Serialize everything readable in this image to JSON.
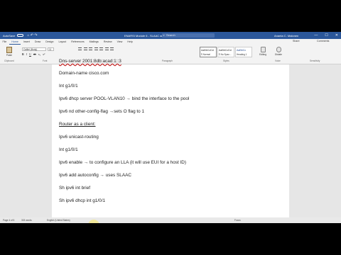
{
  "titlebar": {
    "autosave": "AutoSave",
    "document": "ENARSI Module 6 - SLAAC and DHCPv6",
    "search_placeholder": "Search",
    "user": "Ananta C. Malonen",
    "quick_access": "⌂ ↶ ↷"
  },
  "tabs": [
    "File",
    "Home",
    "Insert",
    "Draw",
    "Design",
    "Layout",
    "References",
    "Mailings",
    "Review",
    "View",
    "Help"
  ],
  "share_label": "Share",
  "comments_label": "Comments",
  "ribbon": {
    "paste_label": "Paste",
    "font_name": "Calibri (Body)",
    "font_size": "11",
    "clipboard_label": "Clipboard",
    "font_label": "Font",
    "paragraph_label": "Paragraph",
    "styles_label": "Styles",
    "editing_label": "Editing",
    "dictate_label": "Dictate",
    "voice_label": "Voice",
    "sensitivity_label": "Sensitivity",
    "styles": [
      {
        "preview": "AaBbCcDd",
        "name": "¶ Normal"
      },
      {
        "preview": "AaBbCcDd",
        "name": "¶ No Spac..."
      },
      {
        "preview": "AaBbCc",
        "name": "Heading 1"
      }
    ],
    "format_buttons": [
      "B",
      "I",
      "U",
      "ab",
      "x₂",
      "x²"
    ]
  },
  "document": {
    "lines": [
      "Dns-server 2001:8db:acad:1::3",
      "Domain-name cisco.com",
      "Int g1/0/1",
      "Ipv6 dhcp server POOL-VLAN10 → bind the interface to the pool",
      "Ipv6 nd other-config-flag →sets O flag to 1",
      "Router as a client:",
      "Ipv6 unicast-routing",
      "Int g1/0/1",
      "Ipv6 enable → to configure an LLA (it will use EUI for a host ID)",
      "Ipv6 add autoconfig → uses SLAAC",
      "Sh ipv6 int brief",
      "Sh ipv6 dhcp int g1/0/1"
    ]
  },
  "status": {
    "page": "Page 4 of 5",
    "words": "303 words",
    "language": "English (United States)",
    "focus": "Focus"
  }
}
